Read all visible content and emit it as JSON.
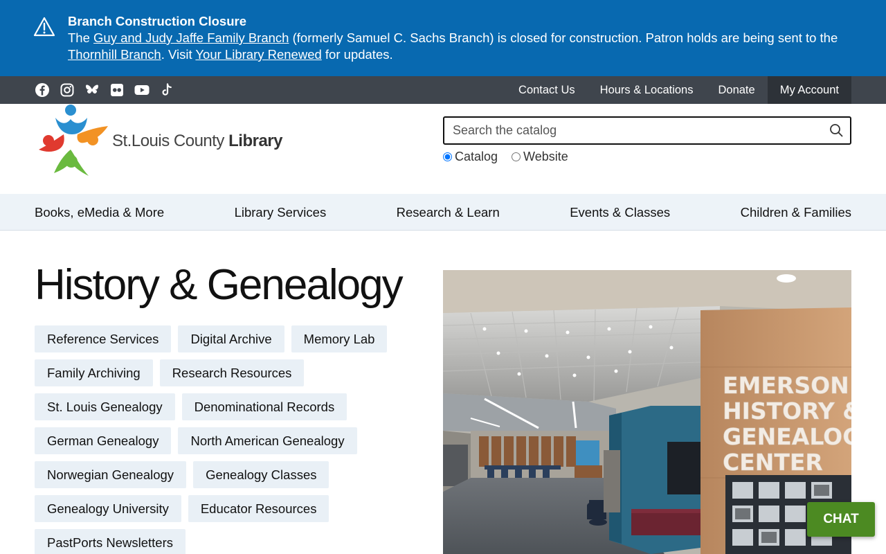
{
  "alert": {
    "title": "Branch Construction Closure",
    "text_1": "The ",
    "link_1": "Guy and Judy Jaffe Family Branch",
    "text_2": " (formerly Samuel C. Sachs Branch) is closed for construction. Patron holds are being sent to the ",
    "link_2": "Thornhill Branch",
    "text_3": ". Visit ",
    "link_3": "Your Library Renewed",
    "text_4": " for updates."
  },
  "social_icons": [
    "facebook-icon",
    "instagram-icon",
    "bluesky-icon",
    "flickr-icon",
    "youtube-icon",
    "tiktok-icon"
  ],
  "utility_nav": {
    "contact": "Contact Us",
    "hours": "Hours & Locations",
    "donate": "Donate",
    "account": "My Account"
  },
  "logo": {
    "text_light": "St.Louis County ",
    "text_bold": "Library"
  },
  "search": {
    "placeholder": "Search the catalog",
    "scope_catalog": "Catalog",
    "scope_website": "Website",
    "selected": "Catalog"
  },
  "main_nav": [
    "Books, eMedia & More",
    "Library Services",
    "Research & Learn",
    "Events & Classes",
    "Children & Families"
  ],
  "page": {
    "title": "History & Genealogy",
    "tags": [
      "Reference Services",
      "Digital Archive",
      "Memory Lab",
      "Family Archiving",
      "Research Resources",
      "St. Louis Genealogy",
      "Denominational Records",
      "German Genealogy",
      "North American Genealogy",
      "Norwegian Genealogy",
      "Genealogy Classes",
      "Genealogy University",
      "Educator Resources",
      "PastPorts Newsletters"
    ]
  },
  "photo": {
    "sign_line_1": "EMERSON",
    "sign_line_2": "HISTORY &",
    "sign_line_3": "GENEALOGY",
    "sign_line_4": "CENTER"
  },
  "chat_label": "CHAT",
  "colors": {
    "banner": "#0869b0",
    "utility_bar": "#3f454d",
    "nav_bg": "#edf3f8",
    "chat": "#4c8a22"
  }
}
